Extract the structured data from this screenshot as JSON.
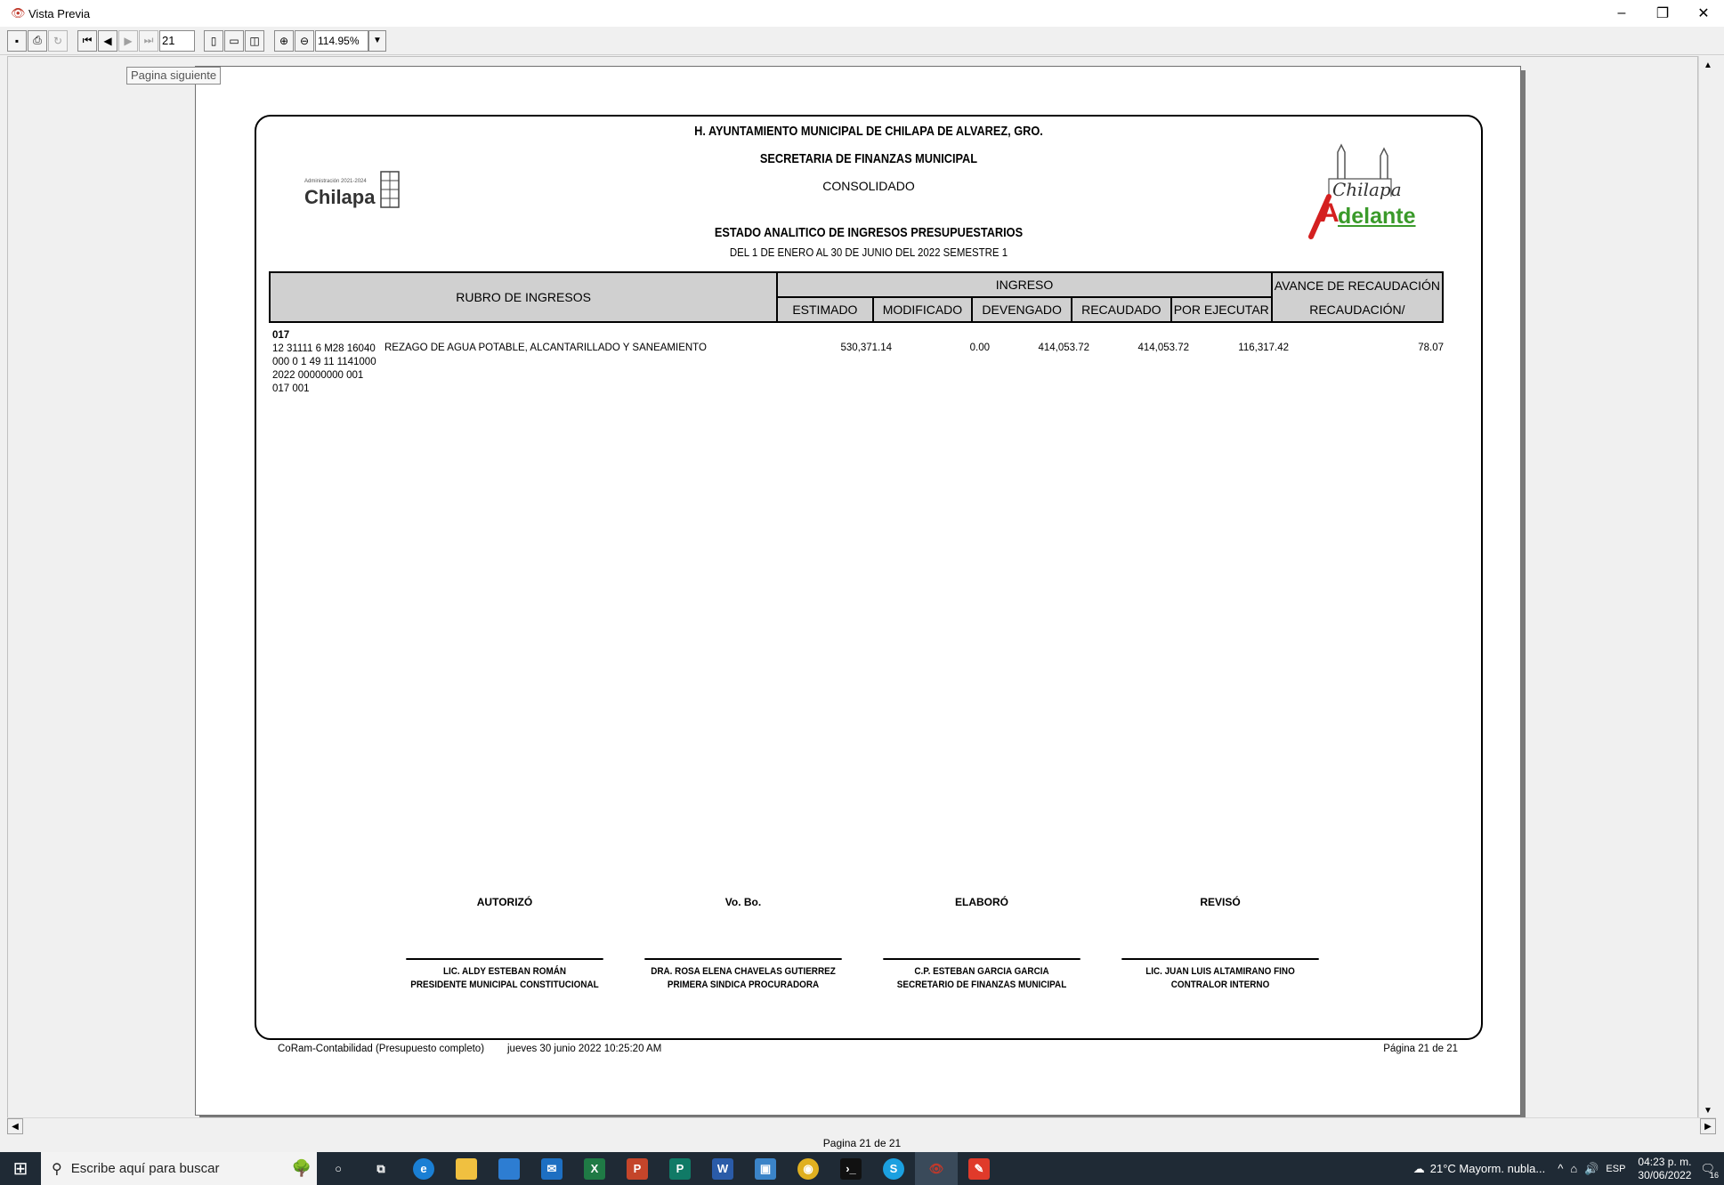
{
  "window": {
    "title": "Vista Previa",
    "icon": "eye-icon",
    "minimize": "–",
    "restore": "❐",
    "close": "✕"
  },
  "toolbar": {
    "page_value": "21",
    "zoom_value": "114.95%",
    "tooltip": "Pagina siguiente"
  },
  "report": {
    "line1": "H. AYUNTAMIENTO MUNICIPAL DE CHILAPA DE ALVAREZ, GRO.",
    "line2": "SECRETARIA DE FINANZAS MUNICIPAL",
    "line3": "CONSOLIDADO",
    "line4": "ESTADO ANALITICO DE INGRESOS PRESUPUESTARIOS",
    "line5": "DEL 1 DE ENERO AL 30 DE JUNIO DEL 2022 SEMESTRE 1",
    "logo_left_small": "Administración 2021-2024",
    "logo_left_name": "Chilapa",
    "logo_right_top": "Chilapa",
    "logo_right_bottom": "delante",
    "logo_right_initial": "A",
    "columns": {
      "rubro": "RUBRO DE INGRESOS",
      "ingreso": "INGRESO",
      "avance": "AVANCE DE RECAUDACIÓN",
      "estimado": "ESTIMADO",
      "modificado": "MODIFICADO",
      "devengado": "DEVENGADO",
      "recaudado": "RECAUDADO",
      "por_ejecutar": "POR EJECUTAR",
      "recaudacion": "RECAUDACIÓN/"
    },
    "rows": [
      {
        "group": "017",
        "code": "12 31111 6 M28 16040 000 0 1 49 11 1141000 2022 00000000 001 017 001",
        "description": "REZAGO DE AGUA POTABLE, ALCANTARILLADO Y SANEAMIENTO",
        "estimado": "530,371.14",
        "modificado": "0.00",
        "devengado": "414,053.72",
        "recaudado": "414,053.72",
        "por_ejecutar": "116,317.42",
        "avance": "78.07"
      }
    ],
    "signatures": [
      {
        "role": "AUTORIZÓ",
        "name": "LIC. ALDY ESTEBAN ROMÁN",
        "title": "PRESIDENTE MUNICIPAL CONSTITUCIONAL"
      },
      {
        "role": "Vo. Bo.",
        "name": "DRA. ROSA ELENA CHAVELAS GUTIERREZ",
        "title": "PRIMERA SINDICA PROCURADORA"
      },
      {
        "role": "ELABORÓ",
        "name": "C.P. ESTEBAN GARCIA GARCIA",
        "title": "SECRETARIO DE FINANZAS MUNICIPAL"
      },
      {
        "role": "REVISÓ",
        "name": "LIC. JUAN LUIS ALTAMIRANO FINO",
        "title": "CONTRALOR INTERNO"
      }
    ],
    "footer_app": "CoRam-Contabilidad (Presupuesto completo)",
    "footer_date": "jueves 30 junio 2022 10:25:20 AM",
    "footer_page": "Página 21 de 21"
  },
  "status": {
    "page_label": "Pagina 21 de 21"
  },
  "taskbar": {
    "search_placeholder": "Escribe aquí para buscar",
    "weather": "21°C  Mayorm. nubla...",
    "lang": "ESP",
    "time": "04:23 p. m.",
    "date": "30/06/2022",
    "notifications": "16"
  },
  "colors": {
    "header_gray": "#d0d0d0",
    "taskbar": "#1f2a35",
    "logo_green": "#3a9a2a",
    "logo_red": "#d42020"
  }
}
